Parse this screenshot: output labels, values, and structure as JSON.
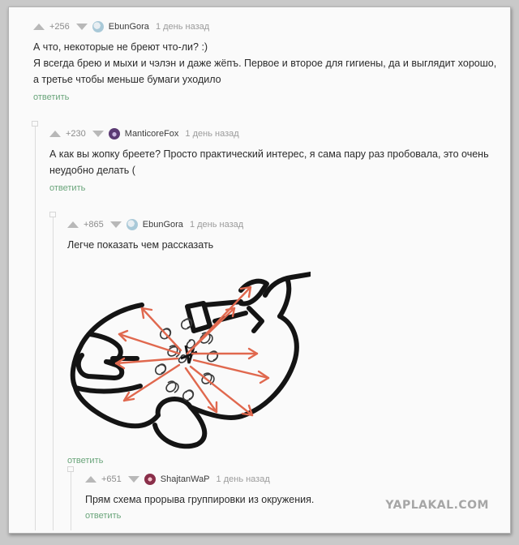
{
  "comments": [
    {
      "rating": "+256",
      "author": "EbunGora",
      "time": "1 день назад",
      "lines": [
        "А что, некоторые не бреют что-ли? :)",
        "Я всегда брею и мыхи и чэлэн и даже жёпъ. Первое и второе для гигиены, да и выглядит хорошо,",
        "а третье чтобы меньше бумаги уходило"
      ],
      "reply": "ответить",
      "avatar_color": "#a9c9d8"
    },
    {
      "rating": "+230",
      "author": "ManticoreFox",
      "time": "1 день назад",
      "lines": [
        "А как вы жопку бреете? Просто практический интерес, я сама пару раз пробовала, это очень",
        "неудобно делать ("
      ],
      "reply": "ответить",
      "avatar_color": "#5b3a73"
    },
    {
      "rating": "+865",
      "author": "EbunGora",
      "time": "1 день назад",
      "lines": [
        "Легче показать чем рассказать"
      ],
      "reply": "ответить",
      "avatar_color": "#a9c9d8"
    },
    {
      "rating": "+651",
      "author": "ShajtanWaP",
      "time": "1 день назад",
      "lines": [
        "Прям схема прорыва группировки из окружения."
      ],
      "reply": "ответить",
      "avatar_color": "#8a2f4a"
    }
  ],
  "watermark": "YAPLAKAL.COM",
  "colors": {
    "reply_link": "#6aa57b",
    "drawing_arrows": "#e0684e",
    "drawing_lines": "#141414"
  }
}
